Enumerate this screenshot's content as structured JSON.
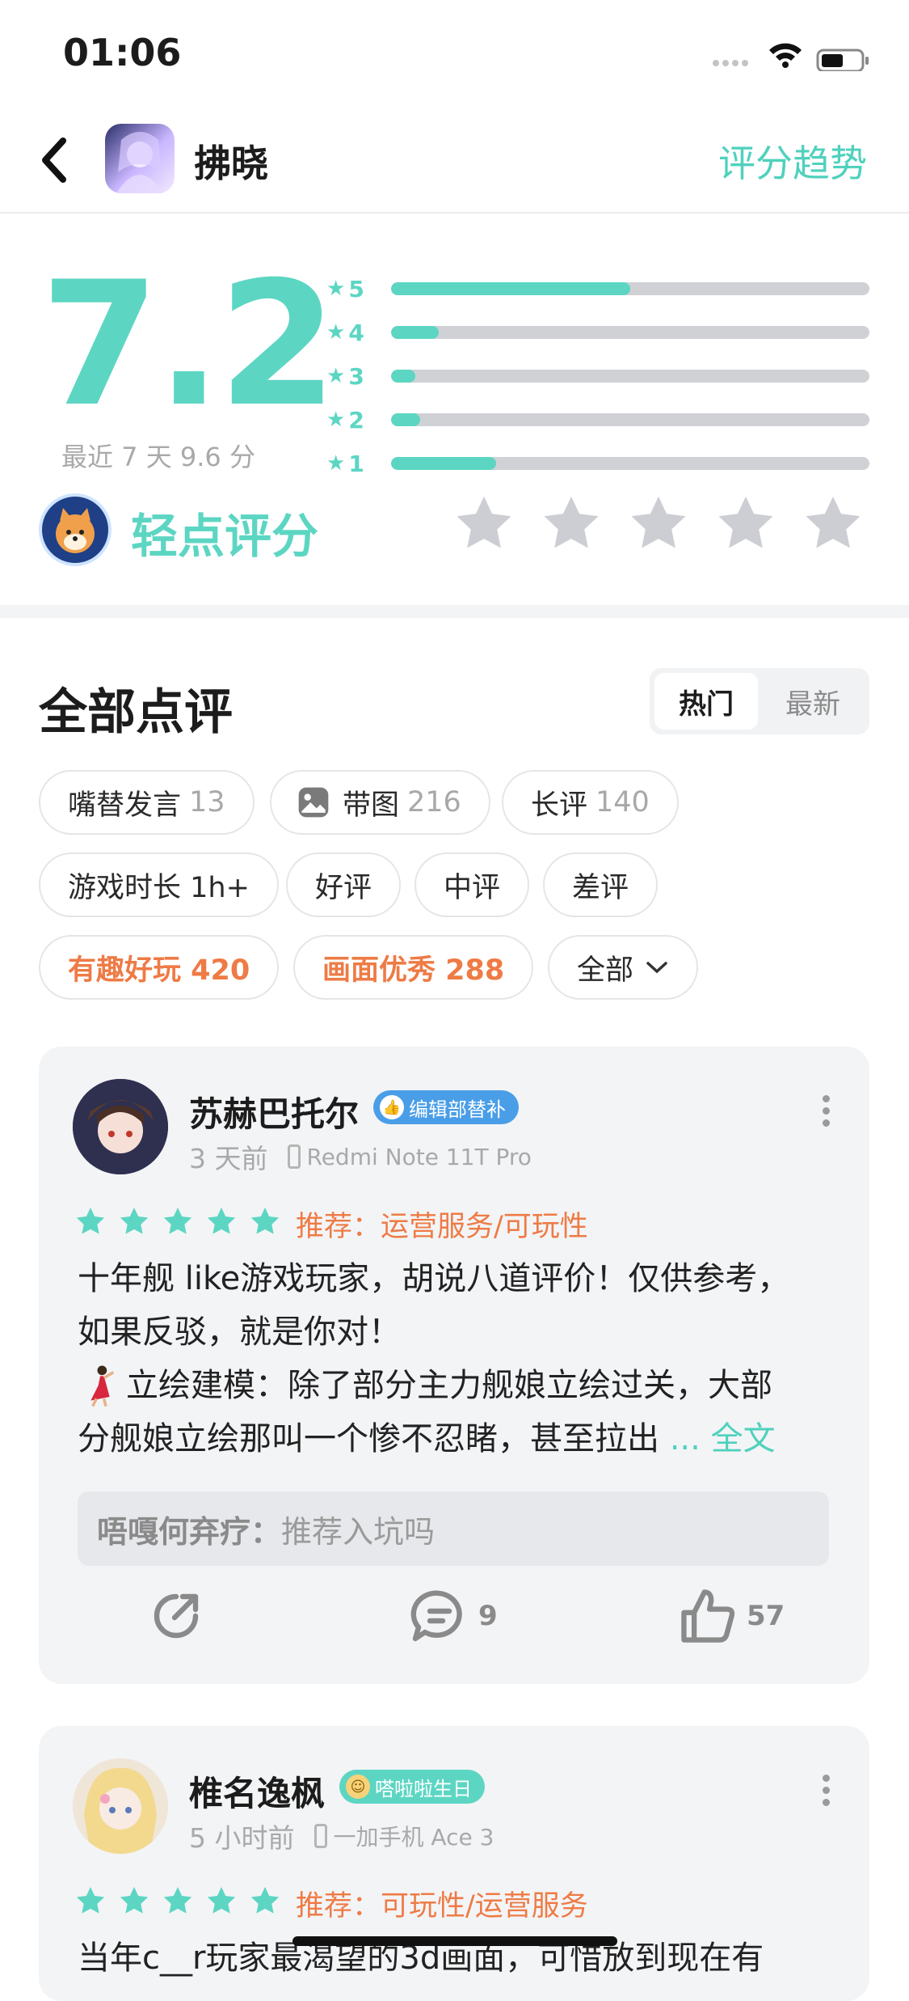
{
  "status": {
    "time": "01:06"
  },
  "nav": {
    "title": "拂晓",
    "trend": "评分趋势"
  },
  "score": {
    "value": "7.2",
    "recent": "最近 7 天 9.6 分",
    "bars": [
      {
        "label": "5",
        "fill": 0.5
      },
      {
        "label": "4",
        "fill": 0.1
      },
      {
        "label": "3",
        "fill": 0.05
      },
      {
        "label": "2",
        "fill": 0.06
      },
      {
        "label": "1",
        "fill": 0.22
      }
    ]
  },
  "tap": {
    "label": "轻点评分"
  },
  "reviews_header": {
    "title": "全部点评",
    "hot": "热门",
    "latest": "最新"
  },
  "chips": {
    "c1": {
      "label": "嘴替发言",
      "count": "13"
    },
    "c2": {
      "label": "带图",
      "count": "216"
    },
    "c3": {
      "label": "长评",
      "count": "140"
    },
    "c4": {
      "label": "游戏时长 1h+"
    },
    "c5": {
      "label": "好评"
    },
    "c6": {
      "label": "中评"
    },
    "c7": {
      "label": "差评"
    },
    "c8": {
      "label": "有趣好玩 420"
    },
    "c9": {
      "label": "画面优秀 288"
    },
    "c10": {
      "label": "全部"
    }
  },
  "review1": {
    "name": "苏赫巴托尔",
    "badge": "编辑部替补",
    "time": "3 天前",
    "device": "Redmi Note 11T Pro",
    "rec": "推荐：运营服务/可玩性",
    "line1": "十年舰 like游戏玩家，胡说八道评价！仅供参考，",
    "line2": "如果反驳，就是你对！",
    "line3": "立绘建模：除了部分主力舰娘立绘过关，大部",
    "line4": "分舰娘立绘那叫一个惨不忍睹，甚至拉出",
    "more": "... 全文",
    "reply_user": "唔嘎何弃疗：",
    "reply_text": "推荐入坑吗",
    "comments": "9",
    "likes": "57"
  },
  "review2": {
    "name": "椎名逸枫",
    "badge": "嗒啦啦生日",
    "time": "5 小时前",
    "device": "一加手机 Ace 3",
    "rec": "推荐：可玩性/运营服务",
    "line1": "当年c__r玩家最渴望的3d画面，可惜放到现在有"
  },
  "colors": {
    "accent": "#5cd6c3",
    "orange": "#ee7b45",
    "star_gray": "#cdced3"
  }
}
